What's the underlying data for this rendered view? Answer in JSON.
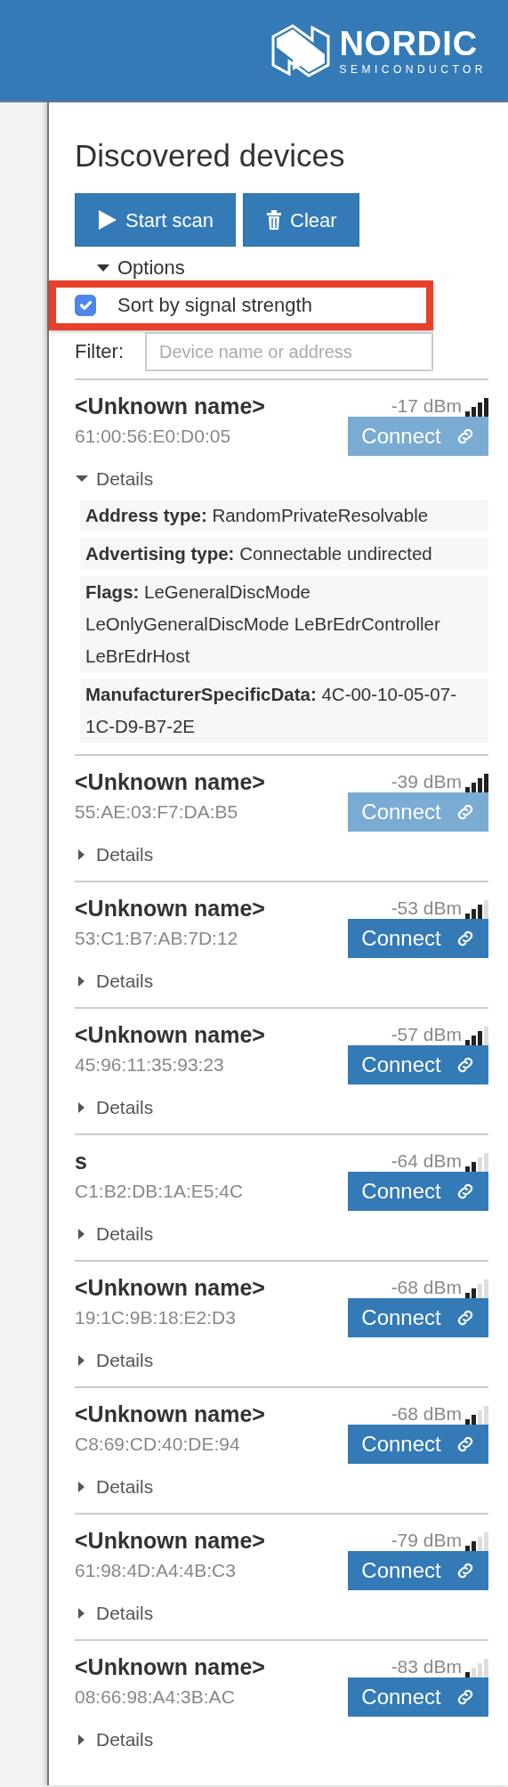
{
  "header": {
    "logo_name": "NORDIC",
    "logo_sub": "SEMICONDUCTOR"
  },
  "title": "Discovered devices",
  "buttons": [
    {
      "label": "Start scan",
      "kind": "play"
    },
    {
      "label": "Clear",
      "kind": "trash"
    }
  ],
  "options": {
    "label": "Options",
    "expanded": true
  },
  "sort_option": {
    "label": "Sort by signal strength",
    "checked": true,
    "highlighted": true
  },
  "filter": {
    "label": "Filter:",
    "placeholder": "Device name or address"
  },
  "devices": [
    {
      "name": "<Unknown name>",
      "rssi": "-17 dBm",
      "level": 1,
      "address": "61:00:56:E0:D0:05",
      "connect": {
        "label": "Connect",
        "disabled": true
      },
      "details": {
        "label": "Details",
        "expanded": true,
        "rows": [
          "**Address type:** RandomPrivateResolvable",
          "**Advertising type:** Connectable undirected",
          "**Flags:** LeGeneralDiscMode LeOnlyGeneralDiscMode LeBrEdrController LeBrEdrHost",
          "**ManufacturerSpecificData:** 4C-00-10-05-07-1C-D9-B7-2E"
        ]
      }
    },
    {
      "name": "<Unknown name>",
      "rssi": "-39 dBm",
      "level": 1,
      "address": "55:AE:03:F7:DA:B5",
      "connect": {
        "label": "Connect",
        "disabled": true
      },
      "details": {
        "label": "Details",
        "expanded": false
      }
    },
    {
      "name": "<Unknown name>",
      "rssi": "-53 dBm",
      "level": 0.75,
      "address": "53:C1:B7:AB:7D:12",
      "connect": {
        "label": "Connect",
        "disabled": false
      },
      "details": {
        "label": "Details",
        "expanded": false
      }
    },
    {
      "name": "<Unknown name>",
      "rssi": "-57 dBm",
      "level": 0.75,
      "address": "45:96:11:35:93:23",
      "connect": {
        "label": "Connect",
        "disabled": false
      },
      "details": {
        "label": "Details",
        "expanded": false
      }
    },
    {
      "name": "s",
      "rssi": "-64 dBm",
      "level": 0.5,
      "address": "C1:B2:DB:1A:E5:4C",
      "connect": {
        "label": "Connect",
        "disabled": false
      },
      "details": {
        "label": "Details",
        "expanded": false
      }
    },
    {
      "name": "<Unknown name>",
      "rssi": "-68 dBm",
      "level": 0.5,
      "address": "19:1C:9B:18:E2:D3",
      "connect": {
        "label": "Connect",
        "disabled": false
      },
      "details": {
        "label": "Details",
        "expanded": false
      }
    },
    {
      "name": "<Unknown name>",
      "rssi": "-68 dBm",
      "level": 0.5,
      "address": "C8:69:CD:40:DE:94",
      "connect": {
        "label": "Connect",
        "disabled": false
      },
      "details": {
        "label": "Details",
        "expanded": false
      }
    },
    {
      "name": "<Unknown name>",
      "rssi": "-79 dBm",
      "level": 0.5,
      "address": "61:98:4D:A4:4B:C3",
      "connect": {
        "label": "Connect",
        "disabled": false
      },
      "details": {
        "label": "Details",
        "expanded": false
      }
    },
    {
      "name": "<Unknown name>",
      "rssi": "-83 dBm",
      "level": 0.25,
      "address": "08:66:98:A4:3B:AC",
      "connect": {
        "label": "Connect",
        "disabled": false
      },
      "details": {
        "label": "Details",
        "expanded": false
      }
    }
  ]
}
